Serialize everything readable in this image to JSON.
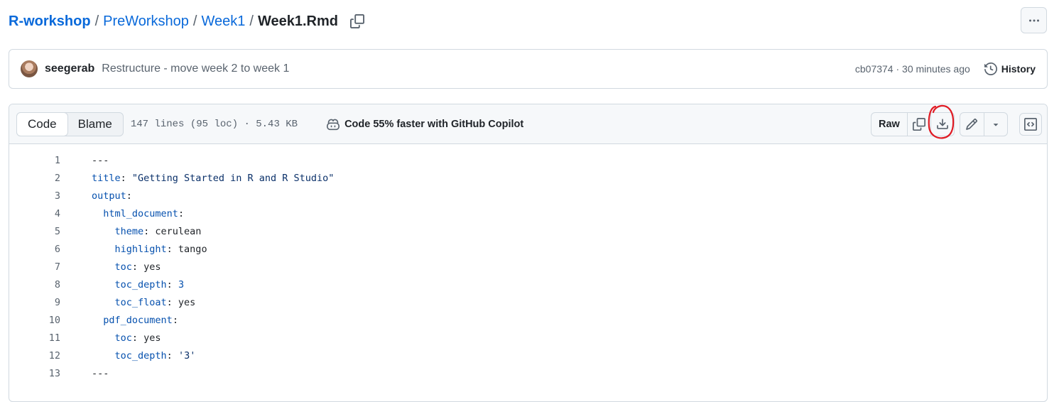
{
  "breadcrumb": {
    "items": [
      "R-workshop",
      "PreWorkshop",
      "Week1"
    ],
    "separator": "/",
    "current": "Week1.Rmd"
  },
  "commit": {
    "author": "seegerab",
    "message": "Restructure - move week 2 to week 1",
    "info": "cb07374 · 30 minutes ago",
    "history_label": "History"
  },
  "file_header": {
    "tabs": [
      "Code",
      "Blame"
    ],
    "active_tab": "Code",
    "meta": "147 lines (95 loc) · 5.43 KB",
    "copilot_text": "Code 55% faster with GitHub Copilot",
    "raw_label": "Raw"
  },
  "colors": {
    "link": "#0969da",
    "yaml_key": "#0550ae",
    "string": "#0a3069",
    "annotation": "#e01b24"
  },
  "code": {
    "lines": [
      {
        "n": "1",
        "indent": "",
        "key": "",
        "rest": "---"
      },
      {
        "n": "2",
        "indent": "",
        "key": "title",
        "rest": ": ",
        "val": "\"Getting Started in R and R Studio\"",
        "valType": "s"
      },
      {
        "n": "3",
        "indent": "",
        "key": "output",
        "rest": ":"
      },
      {
        "n": "4",
        "indent": "  ",
        "key": "html_document",
        "rest": ":"
      },
      {
        "n": "5",
        "indent": "    ",
        "key": "theme",
        "rest": ": cerulean"
      },
      {
        "n": "6",
        "indent": "    ",
        "key": "highlight",
        "rest": ": tango"
      },
      {
        "n": "7",
        "indent": "    ",
        "key": "toc",
        "rest": ": yes"
      },
      {
        "n": "8",
        "indent": "    ",
        "key": "toc_depth",
        "rest": ": ",
        "val": "3",
        "valType": "n"
      },
      {
        "n": "9",
        "indent": "    ",
        "key": "toc_float",
        "rest": ": yes"
      },
      {
        "n": "10",
        "indent": "  ",
        "key": "pdf_document",
        "rest": ":"
      },
      {
        "n": "11",
        "indent": "    ",
        "key": "toc",
        "rest": ": yes"
      },
      {
        "n": "12",
        "indent": "    ",
        "key": "toc_depth",
        "rest": ": ",
        "val": "'3'",
        "valType": "s"
      },
      {
        "n": "13",
        "indent": "",
        "key": "",
        "rest": "---"
      }
    ]
  }
}
